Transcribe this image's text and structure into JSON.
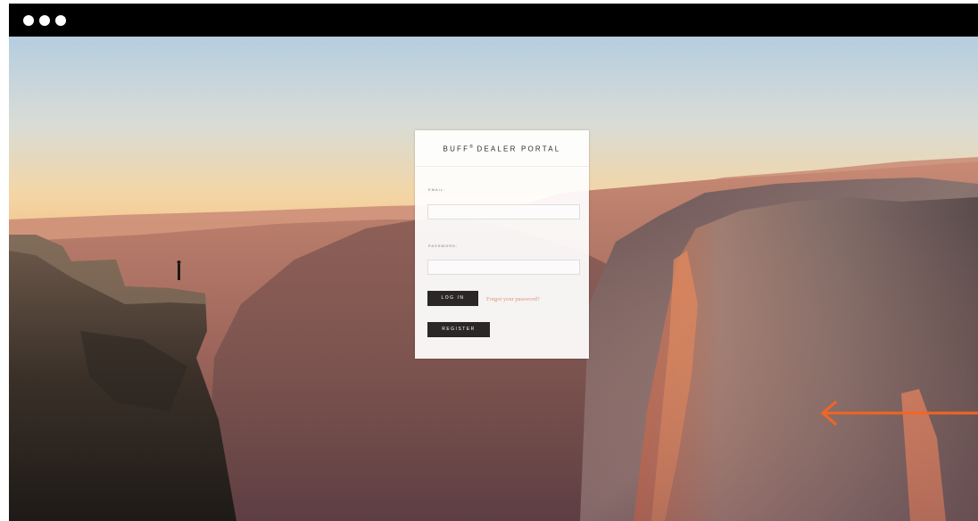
{
  "window": {
    "controls": [
      "close-dot",
      "minimize-dot",
      "maximize-dot"
    ]
  },
  "login": {
    "brand_name": "BUFF",
    "brand_mark": "®",
    "brand_suffix": "DEALER PORTAL",
    "email_label": "EMAIL:",
    "email_value": "",
    "password_label": "PASSWORD:",
    "password_value": "",
    "login_button": "LOG IN",
    "forgot_link": "Forgot your password?",
    "register_button": "REGISTER"
  },
  "colors": {
    "button_bg": "#2b2727",
    "link": "#d9967e",
    "annotation_arrow": "#f26522",
    "titlebar": "#000000"
  },
  "icons": {
    "annotation": "arrow-left-icon"
  }
}
